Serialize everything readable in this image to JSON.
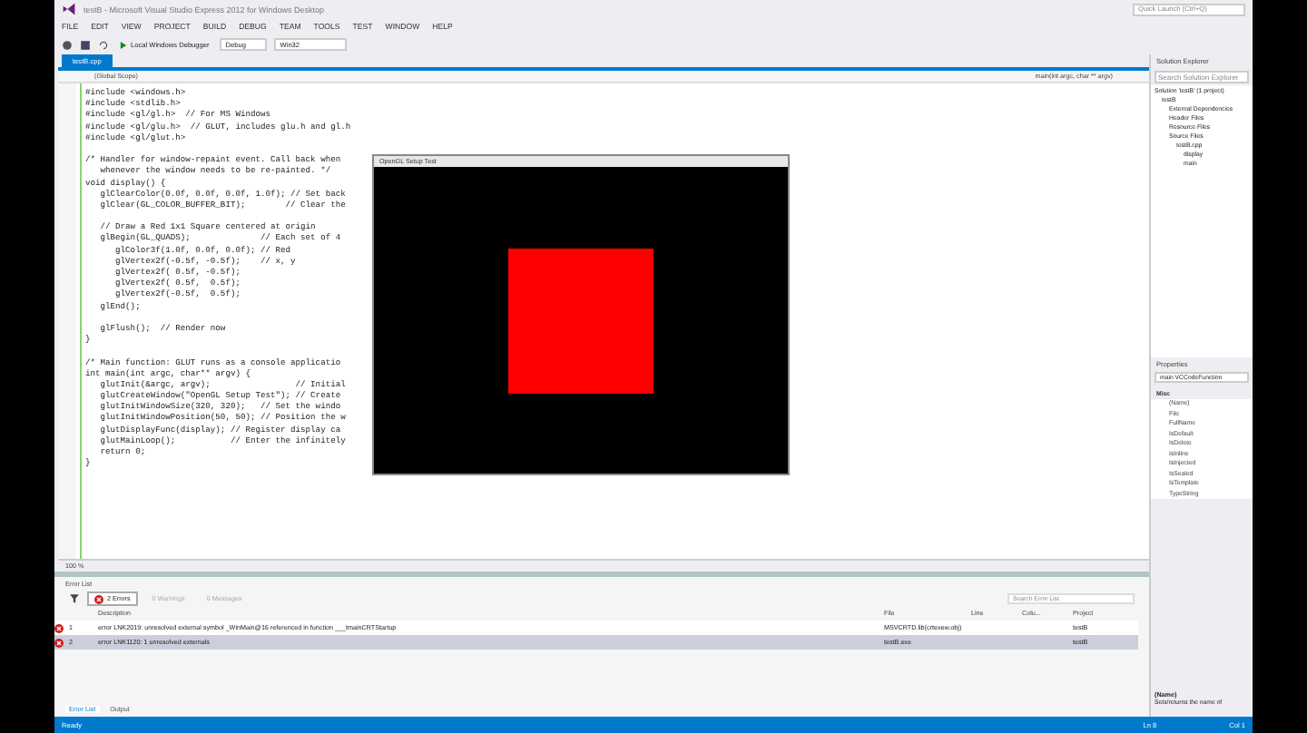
{
  "window": {
    "title": "testB - Microsoft Visual Studio Express 2012 for Windows Desktop",
    "quick_launch": {
      "placeholder": "Quick Launch (Ctrl+Q)"
    }
  },
  "menu": [
    "FILE",
    "EDIT",
    "VIEW",
    "PROJECT",
    "BUILD",
    "DEBUG",
    "TEAM",
    "TOOLS",
    "TEST",
    "WINDOW",
    "HELP"
  ],
  "toolbar": {
    "debugger": "Local Windows Debugger",
    "configuration": "Debug",
    "platform": "Win32"
  },
  "editor": {
    "tabs": [
      {
        "label": "testB.cpp",
        "selected": true
      }
    ],
    "scope": "(Global Scope)",
    "member": "main(int argc, char ** argv)",
    "zoom": "100 %",
    "lines": [
      {
        "kind": "code",
        "text": "#include <windows.h>"
      },
      {
        "kind": "code",
        "text": "#include <stdlib.h>"
      },
      {
        "kind": "code",
        "text": "#include <gl/gl.h>  // For MS Windows"
      },
      {
        "kind": "code",
        "text": "#include <gl/glu.h>  // GLUT, includes glu.h and gl.h"
      },
      {
        "kind": "code",
        "text": "#include <gl/glut.h>"
      },
      {
        "kind": "blank"
      },
      {
        "kind": "code",
        "text": "/* Handler for window-repaint event. Call back when"
      },
      {
        "kind": "code",
        "text": "   whenever the window needs to be re-painted. */"
      },
      {
        "kind": "code",
        "text": "void display() {"
      },
      {
        "kind": "code",
        "text": "   glClearColor(0.0f, 0.0f, 0.0f, 1.0f); // Set back"
      },
      {
        "kind": "code",
        "text": "   glClear(GL_COLOR_BUFFER_BIT);        // Clear the"
      },
      {
        "kind": "blank"
      },
      {
        "kind": "code",
        "text": "   // Draw a Red 1x1 Square centered at origin"
      },
      {
        "kind": "code",
        "text": "   glBegin(GL_QUADS);              // Each set of 4"
      },
      {
        "kind": "code",
        "text": "      glColor3f(1.0f, 0.0f, 0.0f); // Red"
      },
      {
        "kind": "code",
        "text": "      glVertex2f(-0.5f, -0.5f);    // x, y"
      },
      {
        "kind": "code",
        "text": "      glVertex2f( 0.5f, -0.5f);"
      },
      {
        "kind": "code",
        "text": "      glVertex2f( 0.5f,  0.5f);"
      },
      {
        "kind": "code",
        "text": "      glVertex2f(-0.5f,  0.5f);"
      },
      {
        "kind": "code",
        "text": "   glEnd();"
      },
      {
        "kind": "blank"
      },
      {
        "kind": "code",
        "text": "   glFlush();  // Render now"
      },
      {
        "kind": "code",
        "text": "}"
      },
      {
        "kind": "blank"
      },
      {
        "kind": "code",
        "text": "/* Main function: GLUT runs as a console applicatio"
      },
      {
        "kind": "code",
        "text": "int main(int argc, char** argv) {"
      },
      {
        "kind": "code",
        "text": "   glutInit(&argc, argv);                 // Initial"
      },
      {
        "kind": "code",
        "text": "   glutCreateWindow(\"OpenGL Setup Test\"); // Create"
      },
      {
        "kind": "code",
        "text": "   glutInitWindowSize(320, 320);   // Set the windo"
      },
      {
        "kind": "code",
        "text": "   glutInitWindowPosition(50, 50); // Position the w"
      },
      {
        "kind": "code",
        "text": "   glutDisplayFunc(display); // Register display ca"
      },
      {
        "kind": "code",
        "text": "   glutMainLoop();           // Enter the infinitely"
      },
      {
        "kind": "code",
        "text": "   return 0;"
      },
      {
        "kind": "code",
        "text": "}"
      }
    ]
  },
  "gl_window": {
    "title": "OpenGL Setup Test"
  },
  "error_list": {
    "title": "Error List",
    "filters": [
      {
        "label": "2 Errors",
        "selected": true
      },
      {
        "label": "0 Warnings",
        "selected": false
      },
      {
        "label": "0 Messages",
        "selected": false
      }
    ],
    "search": {
      "placeholder": "Search Error List"
    },
    "columns": [
      "Description",
      "File",
      "Line",
      "Colu...",
      "Project"
    ],
    "rows": [
      {
        "number": "1",
        "description": "error LNK2019: unresolved external symbol _WinMain@16 referenced in function ___tmainCRTStartup",
        "file": "MSVCRTD.lib(crtexew.obj)",
        "project": "testB",
        "selected": false
      },
      {
        "number": "2",
        "description": "error LNK1120: 1 unresolved externals",
        "file": "testB.exe",
        "project": "testB",
        "selected": true
      }
    ]
  },
  "bottom_tabs": [
    {
      "label": "Error List",
      "selected": true
    },
    {
      "label": "Output",
      "selected": false
    }
  ],
  "solution_explorer": {
    "title": "Solution Explorer",
    "search": {
      "placeholder": "Search Solution Explorer"
    },
    "tree": [
      {
        "label": "Solution 'testB' (1 project)",
        "children": [
          {
            "label": "testB",
            "children": [
              {
                "label": "External Dependencies"
              },
              {
                "label": "Header Files"
              },
              {
                "label": "Resource Files"
              },
              {
                "label": "Source Files",
                "children": [
                  {
                    "label": "testB.cpp",
                    "children": [
                      {
                        "label": "display"
                      },
                      {
                        "label": "main"
                      }
                    ]
                  }
                ]
              }
            ]
          }
        ]
      }
    ]
  },
  "properties": {
    "title": "Properties",
    "object": "main VCCodeFunction",
    "category": "Misc",
    "items": [
      "(Name)",
      "File",
      "FullName",
      "IsDefault",
      "IsDelete",
      "IsInline",
      "IsInjected",
      "IsSealed",
      "IsTemplate",
      "TypeString"
    ],
    "description_title": "(Name)",
    "description": "Sets/returns the name of"
  },
  "status_bar": {
    "text": "Ready",
    "line": "Ln 8",
    "column": "Col 1"
  }
}
